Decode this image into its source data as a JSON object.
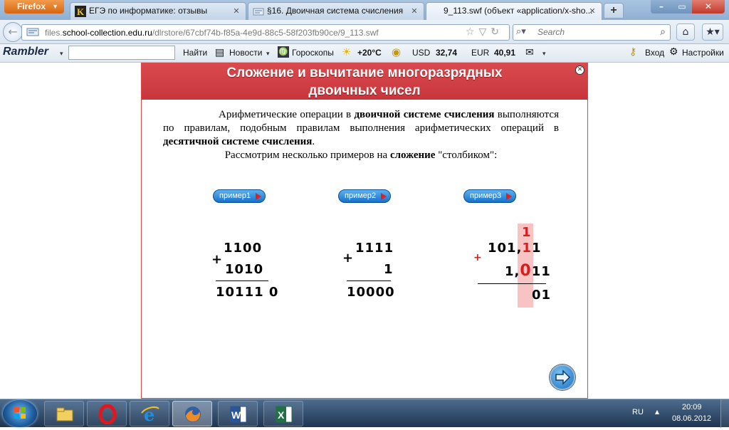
{
  "browser": {
    "menu_label": "Firefox",
    "tabs": [
      {
        "label": "ЕГЭ по информатике: отзывы",
        "active": false
      },
      {
        "label": "§16. Двоичная система счисления",
        "active": false
      },
      {
        "label": "9_113.swf (объект «application/x-sho...",
        "active": true
      }
    ],
    "url_prefix": "files.",
    "url_domain": "school-collection.edu.ru",
    "url_path": "/dlrstore/67cbf74b-f85a-4e9d-88c5-58f203fb90ce/9_113.swf",
    "search_placeholder": "Search"
  },
  "rambler": {
    "logo": "Rambler",
    "find_label": "Найти",
    "news_label": "Новости",
    "horoscope_label": "Гороскопы",
    "weather": "+20°C",
    "usd_label": "USD",
    "usd_value": "32,74",
    "eur_label": "EUR",
    "eur_value": "40,91",
    "login_label": "Вход",
    "settings_label": "Настройки"
  },
  "lesson": {
    "title_line1": "Сложение и вычитание многоразрядных",
    "title_line2": "двоичных чисел",
    "p1_a": "Арифметические операции в ",
    "p1_b": "двоичной системе счисления",
    "p1_c": " выполняются  по правилам, подобным правилам выполнения арифметических операций в ",
    "p1_d": "десятичной системе счисления",
    "p1_e": ".",
    "p2_a": "Рассмотрим несколько примеров на ",
    "p2_b": "сложение",
    "p2_c": "  \"столбиком\":",
    "buttons": [
      "пример1",
      "пример2",
      "пример3"
    ],
    "ex1": {
      "a": "1100",
      "b": "1010",
      "sum": "10111 0",
      "op": "+"
    },
    "ex2": {
      "a": "1111",
      "b": "1",
      "sum": "10000",
      "op": "+"
    },
    "ex3": {
      "carry": "1",
      "a_int": "101",
      "a_comma": ",",
      "a_red": "1",
      "a_rest": "1",
      "b_int": "1",
      "b_comma": ",",
      "b_red": "0",
      "b_rest": "11",
      "sum": "01",
      "op": "+"
    }
  },
  "taskbar": {
    "lang": "RU",
    "time": "20:09",
    "date": "08.06.2012"
  }
}
